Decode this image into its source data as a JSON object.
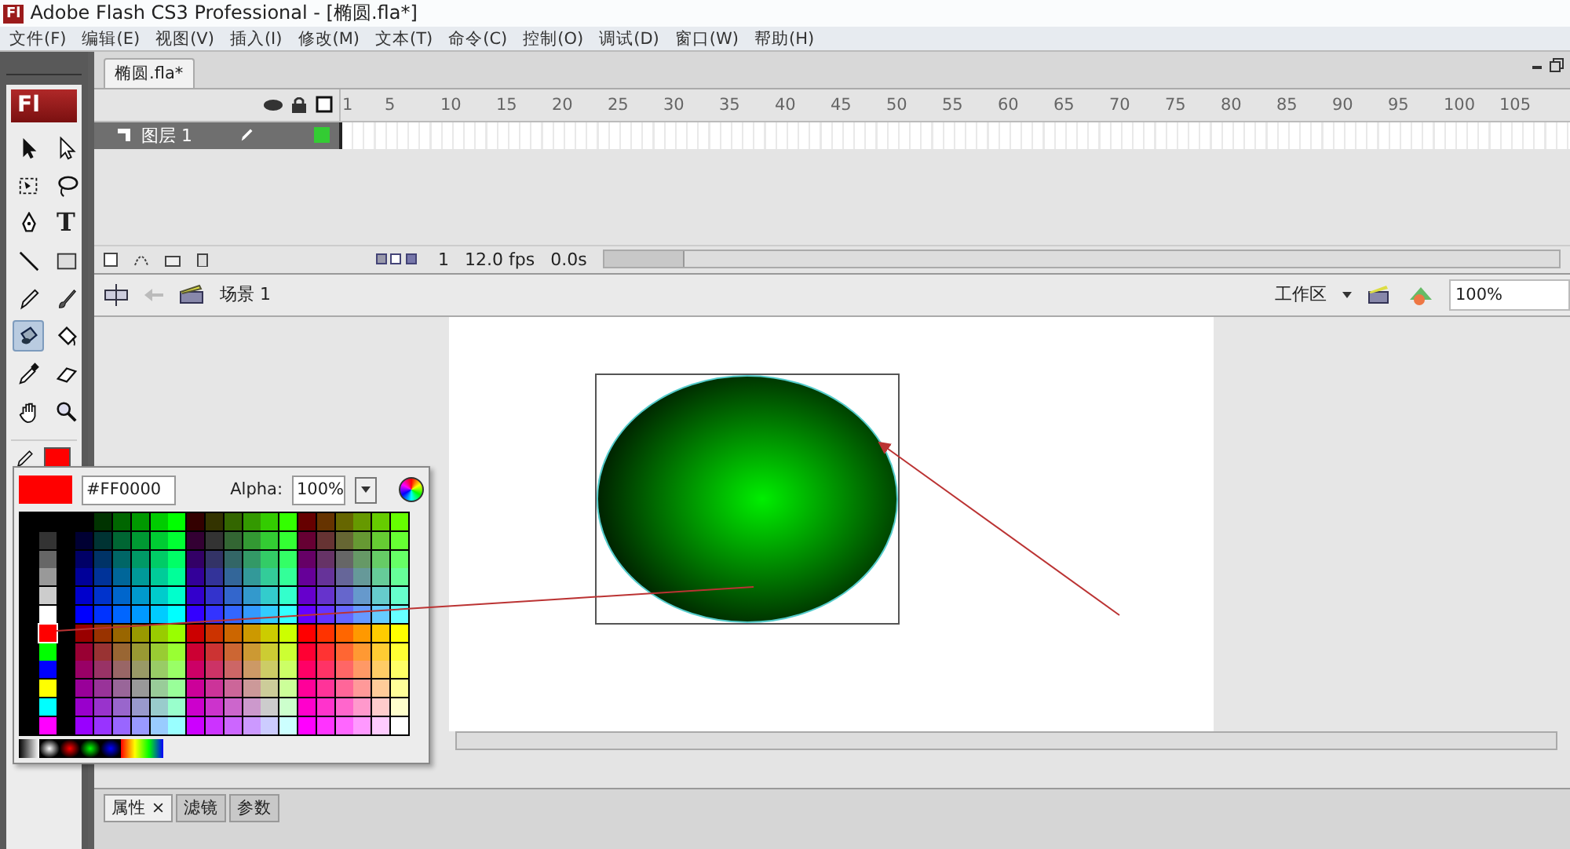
{
  "window": {
    "title": "Adobe Flash CS3 Professional - [椭圆.fla*]",
    "logo": "Fl"
  },
  "menu": [
    "文件(F)",
    "编辑(E)",
    "视图(V)",
    "插入(I)",
    "修改(M)",
    "文本(T)",
    "命令(C)",
    "控制(O)",
    "调试(D)",
    "窗口(W)",
    "帮助(H)"
  ],
  "toolbox": {
    "logo": "Fl",
    "text_tool_glyph": "T",
    "tools": [
      {
        "kind": "arrow",
        "selected": false
      },
      {
        "kind": "subselect",
        "selected": false
      },
      {
        "kind": "transform",
        "selected": false
      },
      {
        "kind": "lasso",
        "selected": false
      },
      {
        "kind": "pen",
        "selected": false
      },
      {
        "kind": "text",
        "selected": false
      },
      {
        "kind": "line",
        "selected": false
      },
      {
        "kind": "rect",
        "selected": false
      },
      {
        "kind": "pencil",
        "selected": false
      },
      {
        "kind": "brush",
        "selected": false
      },
      {
        "kind": "inkbottle",
        "selected": true
      },
      {
        "kind": "bucket",
        "selected": false
      },
      {
        "kind": "eyedropper",
        "selected": false
      },
      {
        "kind": "eraser",
        "selected": false
      },
      {
        "kind": "hand",
        "selected": false
      },
      {
        "kind": "zoom",
        "selected": false
      }
    ]
  },
  "document_tab": {
    "label": "椭圆.fla*"
  },
  "timeline": {
    "frame_numbers": [
      "1",
      "5",
      "10",
      "15",
      "20",
      "25",
      "30",
      "35",
      "40",
      "45",
      "50",
      "55",
      "60",
      "65",
      "70",
      "75",
      "80",
      "85",
      "90",
      "95",
      "100",
      "105"
    ],
    "layers": [
      {
        "name": "图层 1",
        "selected": true,
        "color": "#33cc33"
      }
    ],
    "current_frame": "1",
    "frame_rate": "12.0 fps",
    "elapsed": "0.0s"
  },
  "stage_bar": {
    "scene": "场景 1",
    "workspace": "工作区",
    "zoom": "100%"
  },
  "color_picker": {
    "hex": "#FF0000",
    "alpha_label": "Alpha:",
    "alpha": "100%"
  },
  "properties_panel": {
    "tabs": [
      {
        "label": "属性",
        "selected": true,
        "close": "×"
      },
      {
        "label": "滤镜",
        "selected": false
      },
      {
        "label": "参数",
        "selected": false
      }
    ]
  }
}
